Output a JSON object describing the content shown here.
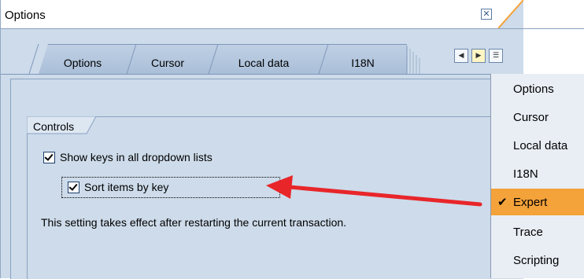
{
  "window": {
    "title": "Options"
  },
  "tabs": [
    {
      "label": "Options"
    },
    {
      "label": "Cursor"
    },
    {
      "label": "Local data"
    },
    {
      "label": "I18N"
    }
  ],
  "nav": {
    "prev_icon": "arrow-left-icon",
    "next_icon": "arrow-right-icon",
    "list_icon": "tab-list-icon"
  },
  "group": {
    "label": "Controls"
  },
  "checkboxes": [
    {
      "label": "Show keys in all dropdown lists",
      "checked": true
    },
    {
      "label": "Sort items by key",
      "checked": true
    }
  ],
  "note": "This setting takes effect after restarting the current transaction.",
  "menu": {
    "items": [
      "Options",
      "Cursor",
      "Local data",
      "I18N",
      "Expert",
      "Trace",
      "Scripting"
    ],
    "selected": "Expert"
  },
  "colors": {
    "accent": "#f4a23a",
    "arrow": "#e8262a",
    "background": "#cddbea"
  }
}
